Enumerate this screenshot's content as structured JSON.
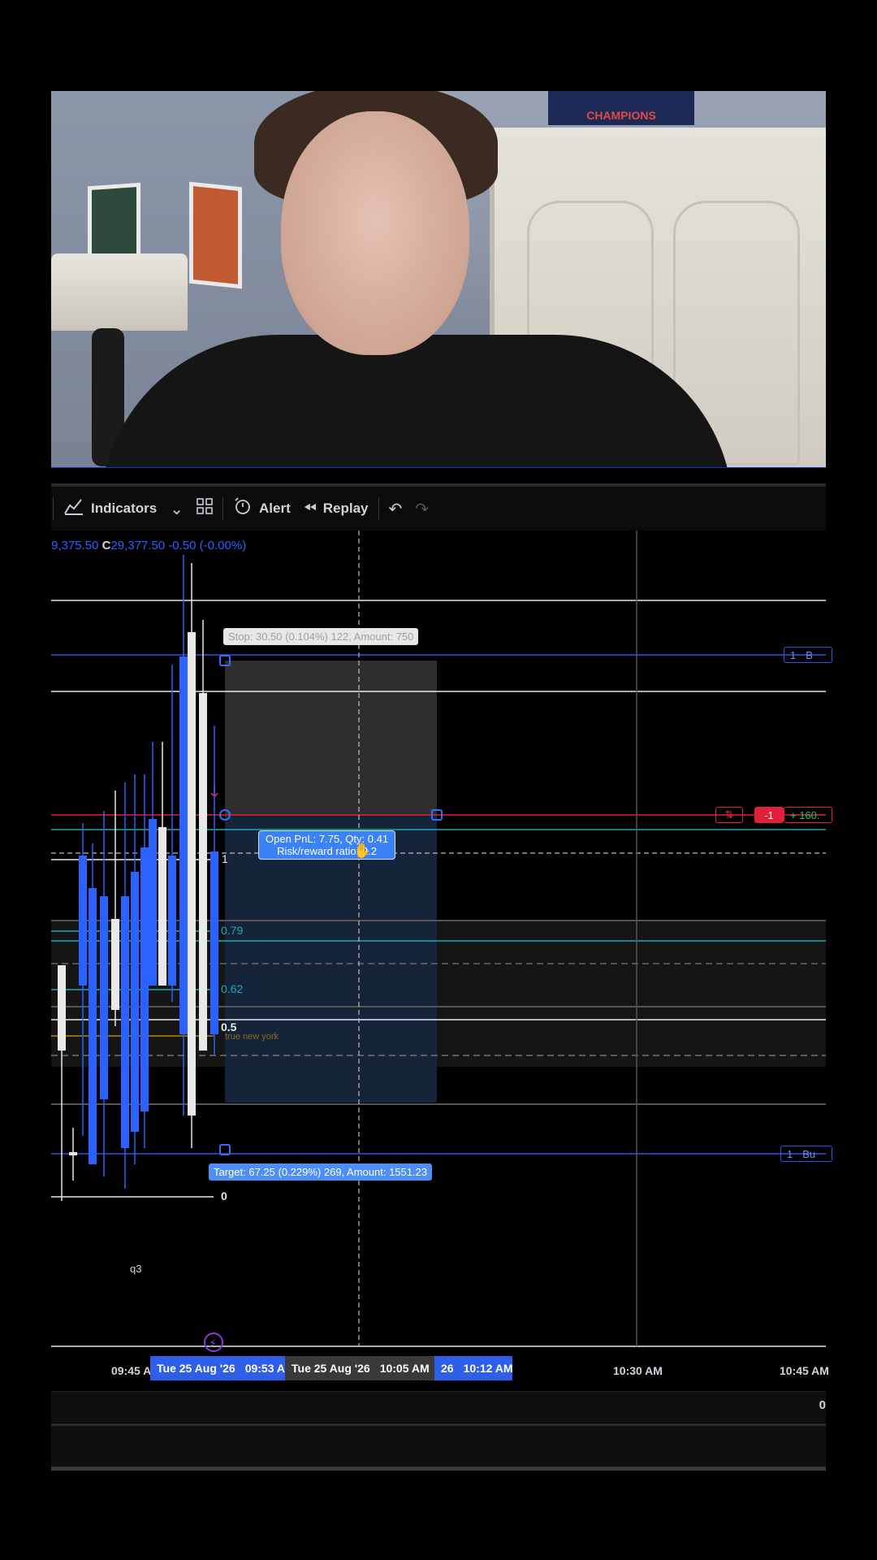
{
  "toolbar": {
    "indicators_label": "Indicators",
    "alert_label": "Alert",
    "replay_label": "Replay"
  },
  "chart_header": {
    "ohlc_prefix": "9,375.50",
    "close_label": "C",
    "close_value": "29,377.50",
    "change": "-0.50 (-0.00%)"
  },
  "position": {
    "stop_label": "Stop: 30.50 (0.104%) 122, Amount: 750",
    "target_label": "Target: 67.25 (0.229%) 269, Amount: 1551.23",
    "pnl_line1": "Open PnL: 7.75, Qty: 0.41",
    "pnl_line2": "Risk/reward ratio: 2.2"
  },
  "fib_levels": {
    "level_1": "1",
    "level_079": "0.79",
    "level_062": "0.62",
    "level_05": "0.5",
    "level_0": "0",
    "session_label": "true new york",
    "q_label": "q3"
  },
  "right_scale": {
    "order_top": "1",
    "order_top_side": "B",
    "order_bottom": "1",
    "order_bottom_side": "Bu",
    "pos_qty": "-1",
    "pos_pnl": "+ 160."
  },
  "time_axis": {
    "t1": "09:45 A",
    "pill_left": "Tue 25 Aug '26",
    "pill_left_time": "09:53 A",
    "pill_mid": "Tue 25 Aug '26",
    "pill_mid_time": "10:05 AM",
    "pill_right_prefix": "26",
    "pill_right_time": "10:12 AM",
    "t2": "10:30 AM",
    "t3": "10:45 AM"
  },
  "bottom": {
    "clip_text": "0"
  },
  "colors": {
    "accent_blue": "#2962ff",
    "target_fill": "#16243a",
    "stop_fill": "#2e2e2e",
    "entry_red": "#e0203a",
    "teal": "#22a6b3"
  },
  "chart_data": {
    "type": "candlestick",
    "candles": [
      {
        "dir": "down"
      },
      {
        "dir": "down"
      },
      {
        "dir": "up"
      },
      {
        "dir": "up"
      },
      {
        "dir": "up"
      },
      {
        "dir": "down"
      },
      {
        "dir": "up"
      },
      {
        "dir": "up"
      },
      {
        "dir": "up"
      },
      {
        "dir": "up"
      },
      {
        "dir": "down"
      },
      {
        "dir": "up"
      },
      {
        "dir": "up"
      },
      {
        "dir": "down"
      },
      {
        "dir": "down"
      },
      {
        "dir": "up"
      }
    ]
  }
}
